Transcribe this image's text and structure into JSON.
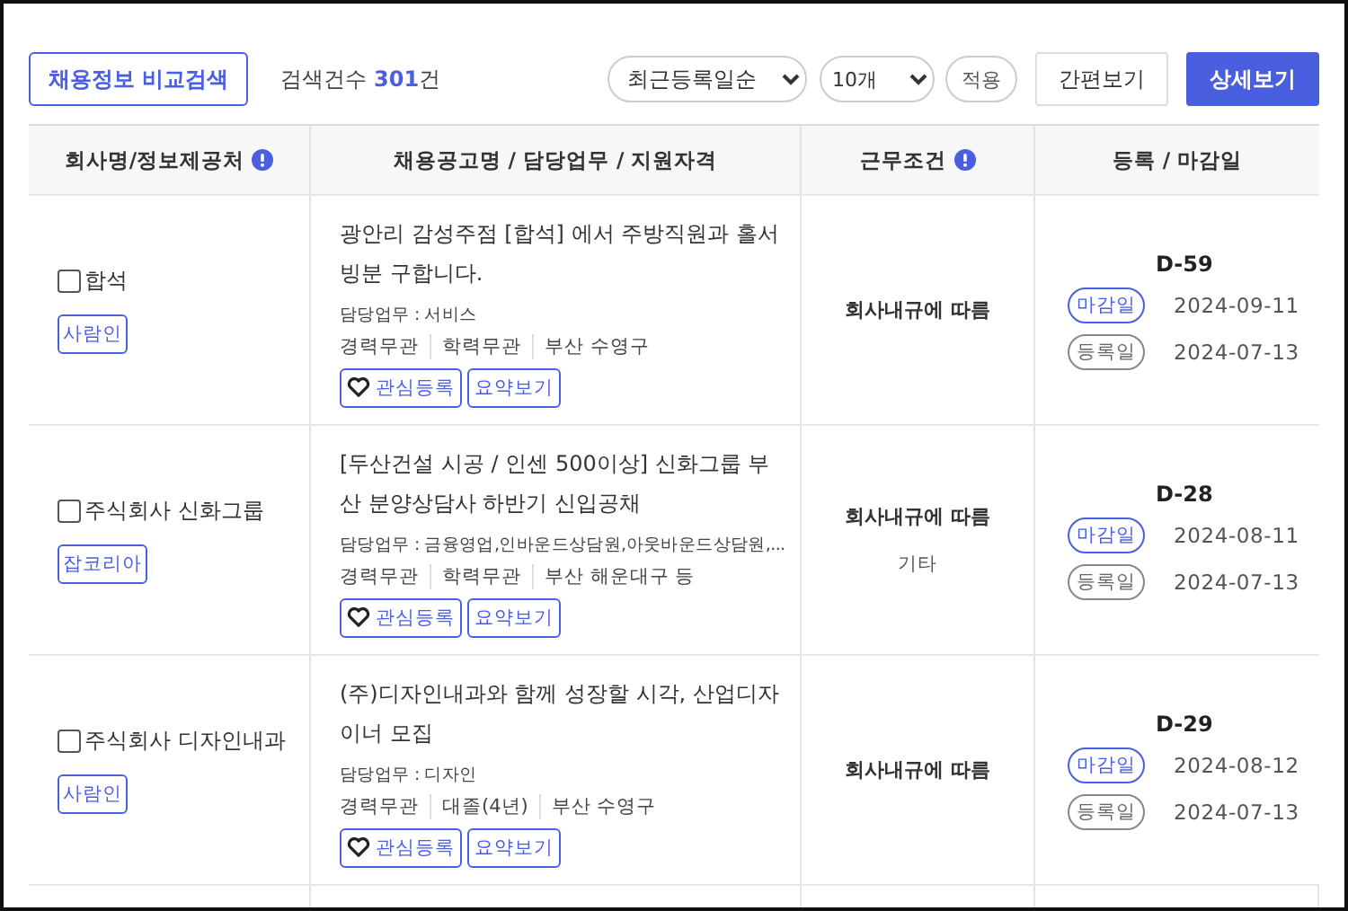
{
  "toolbar": {
    "compare_button": "채용정보 비교검색",
    "count": {
      "label": "검색건수",
      "value": "301",
      "unit": "건"
    },
    "sort_select": "최근등록일순",
    "size_select": "10개",
    "apply_button": "적용",
    "view_buttons": [
      {
        "label": "간편보기",
        "selected": false
      },
      {
        "label": "상세보기",
        "selected": true
      }
    ]
  },
  "table": {
    "columns": [
      {
        "label": "회사명/정보제공처",
        "info": true
      },
      {
        "label": "채용공고명 / 담당업무 / 지원자격",
        "info": false
      },
      {
        "label": "근무조건",
        "info": true
      },
      {
        "label": "등록 / 마감일",
        "info": false
      }
    ],
    "rows": [
      {
        "company": "합석",
        "checked": false,
        "source": "사람인",
        "title": "광안리 감성주점 [합석] 에서 주방직원과 홀서빙분 구합니다.",
        "duty": "담당업무 : 서비스",
        "tags": [
          "경력무관",
          "학력무관",
          "부산 수영구"
        ],
        "actions": [
          {
            "label": "관심등록",
            "kind": "favorite"
          },
          {
            "label": "요약보기",
            "kind": "summary"
          }
        ],
        "conditions": [
          "회사내규에 따름"
        ],
        "dday": "D-59",
        "dates": [
          {
            "kind": "deadline",
            "label": "마감일",
            "date": "2024-09-11"
          },
          {
            "kind": "registered",
            "label": "등록일",
            "date": "2024-07-13"
          }
        ]
      },
      {
        "company": "주식회사 신화그룹",
        "checked": false,
        "source": "잡코리아",
        "title": "[두산건설 시공 / 인센 500이상] 신화그룹 부산 분양상담사 하반기 신입공채",
        "duty": "담당업무 : 금융영업,인바운드상담원,아웃바운드상담원,...",
        "tags": [
          "경력무관",
          "학력무관",
          "부산 해운대구 등"
        ],
        "actions": [
          {
            "label": "관심등록",
            "kind": "favorite"
          },
          {
            "label": "요약보기",
            "kind": "summary"
          }
        ],
        "conditions": [
          "회사내규에 따름",
          "기타"
        ],
        "dday": "D-28",
        "dates": [
          {
            "kind": "deadline",
            "label": "마감일",
            "date": "2024-08-11"
          },
          {
            "kind": "registered",
            "label": "등록일",
            "date": "2024-07-13"
          }
        ]
      },
      {
        "company": "주식회사 디자인내과",
        "checked": false,
        "source": "사람인",
        "title": "(주)디자인내과와 함께 성장할 시각, 산업디자이너 모집",
        "duty": "담당업무 : 디자인",
        "tags": [
          "경력무관",
          "대졸(4년)",
          "부산 수영구"
        ],
        "actions": [
          {
            "label": "관심등록",
            "kind": "favorite"
          },
          {
            "label": "요약보기",
            "kind": "summary"
          }
        ],
        "conditions": [
          "회사내규에 따름"
        ],
        "dday": "D-29",
        "dates": [
          {
            "kind": "deadline",
            "label": "마감일",
            "date": "2024-08-12"
          },
          {
            "kind": "registered",
            "label": "등록일",
            "date": "2024-07-13"
          }
        ]
      }
    ]
  }
}
